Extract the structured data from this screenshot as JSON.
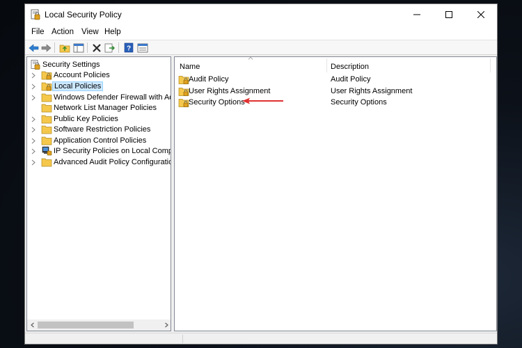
{
  "window": {
    "title": "Local Security Policy",
    "controls": [
      "minimize",
      "maximize",
      "close"
    ]
  },
  "menubar": {
    "items": [
      {
        "label": "File"
      },
      {
        "label": "Action"
      },
      {
        "label": "View"
      },
      {
        "label": "Help"
      }
    ]
  },
  "toolbar": {
    "buttons": [
      "back-arrow-icon",
      "forward-arrow-icon",
      "up-folder-icon",
      "show-hide-tree-icon",
      "delete-icon",
      "export-list-icon",
      "help-icon",
      "properties-icon"
    ]
  },
  "tree": {
    "root": {
      "label": "Security Settings",
      "icon": "security-settings-icon"
    },
    "items": [
      {
        "label": "Account Policies",
        "icon": "locked-folder-icon",
        "expandable": true,
        "selected": false
      },
      {
        "label": "Local Policies",
        "icon": "locked-folder-icon",
        "expandable": true,
        "selected": true
      },
      {
        "label": "Windows Defender Firewall with Advan",
        "icon": "folder-icon",
        "expandable": true,
        "selected": false
      },
      {
        "label": "Network List Manager Policies",
        "icon": "folder-icon",
        "expandable": false,
        "selected": false
      },
      {
        "label": "Public Key Policies",
        "icon": "folder-icon",
        "expandable": true,
        "selected": false
      },
      {
        "label": "Software Restriction Policies",
        "icon": "folder-icon",
        "expandable": true,
        "selected": false
      },
      {
        "label": "Application Control Policies",
        "icon": "folder-icon",
        "expandable": true,
        "selected": false
      },
      {
        "label": "IP Security Policies on Local Computer",
        "icon": "ip-security-icon",
        "expandable": true,
        "selected": false
      },
      {
        "label": "Advanced Audit Policy Configuration",
        "icon": "folder-icon",
        "expandable": true,
        "selected": false
      }
    ]
  },
  "list": {
    "columns": {
      "name": "Name",
      "description": "Description"
    },
    "rows": [
      {
        "name": "Audit Policy",
        "description": "Audit Policy",
        "icon": "locked-folder-icon"
      },
      {
        "name": "User Rights Assignment",
        "description": "User Rights Assignment",
        "icon": "locked-folder-icon"
      },
      {
        "name": "Security Options",
        "description": "Security Options",
        "icon": "locked-folder-icon"
      }
    ]
  },
  "annotation": {
    "type": "red-arrow",
    "target": "Security Options",
    "color": "#e03131"
  },
  "colors": {
    "selection_bg": "#cce8ff",
    "selection_border": "#99d1ff",
    "folder": "#f5c84c",
    "accent_blue": "#1c7ed6"
  }
}
